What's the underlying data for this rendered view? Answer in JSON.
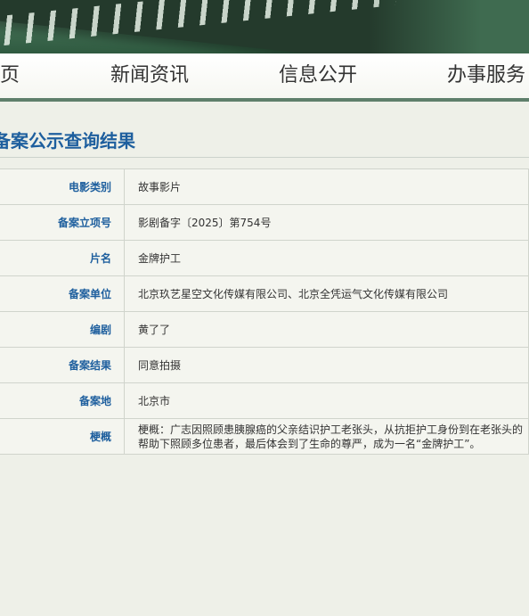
{
  "nav": {
    "items": [
      "页",
      "新闻资讯",
      "信息公开",
      "办事服务"
    ]
  },
  "page": {
    "title": "备案公示查询结果"
  },
  "record": [
    {
      "label": "电影类别",
      "value": "故事影片"
    },
    {
      "label": "备案立项号",
      "value": "影剧备字〔2025〕第754号"
    },
    {
      "label": "片名",
      "value": "金牌护工"
    },
    {
      "label": "备案单位",
      "value": "北京玖艺星空文化传媒有限公司、北京全凭运气文化传媒有限公司"
    },
    {
      "label": "编剧",
      "value": "黄了了"
    },
    {
      "label": "备案结果",
      "value": "同意拍摄"
    },
    {
      "label": "备案地",
      "value": "北京市"
    },
    {
      "label": "梗概",
      "value": "梗概：广志因照顾患胰腺癌的父亲结识护工老张头，从抗拒护工身份到在老张头的帮助下照顾多位患者，最后体会到了生命的尊严，成为一名“金牌护工”。"
    }
  ],
  "colors": {
    "accent": "#1e5f9e",
    "nav_border": "#5f7f6b",
    "banner": "#3f6b50"
  }
}
